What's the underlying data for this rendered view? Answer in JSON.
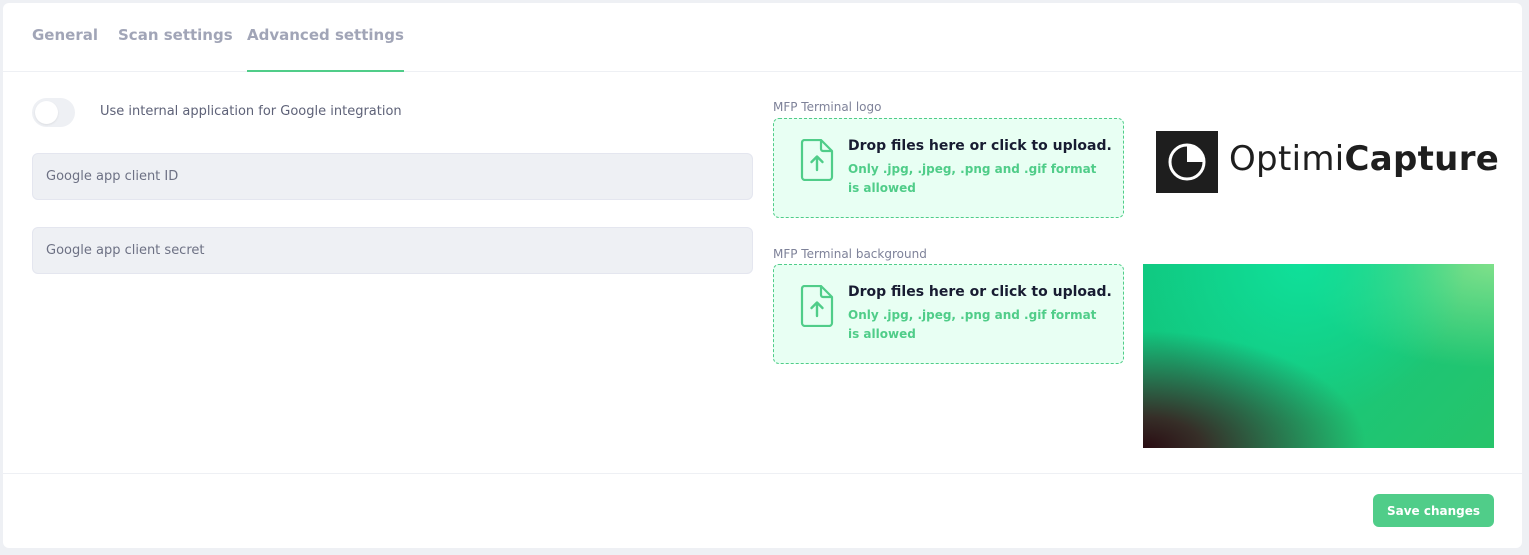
{
  "tabs": [
    {
      "label": "General",
      "active": false
    },
    {
      "label": "Scan settings",
      "active": false
    },
    {
      "label": "Advanced settings",
      "active": true
    }
  ],
  "google_integration": {
    "toggle_label": "Use internal application for Google integration",
    "toggle_on": false,
    "client_id": {
      "value": "",
      "placeholder": "Google app client ID"
    },
    "client_secret": {
      "value": "",
      "placeholder": "Google app client secret"
    }
  },
  "uploads": {
    "logo": {
      "label": "MFP Terminal logo",
      "title": "Drop files here or click to upload.",
      "hint": "Only .jpg, .jpeg, .png and .gif format is allowed"
    },
    "background": {
      "label": "MFP Terminal background",
      "title": "Drop files here or click to upload.",
      "hint": "Only .jpg, .jpeg, .png and .gif format is allowed"
    }
  },
  "logo_preview": {
    "brand_light": "Optimi",
    "brand_bold": "Capture"
  },
  "footer": {
    "save_label": "Save changes"
  },
  "colors": {
    "accent": "#50cd89",
    "dropzone_bg": "#e8fff3",
    "input_bg": "#eef0f4"
  },
  "icons": {
    "upload": "file-upload-icon",
    "logo_mark": "pie-chart-logo-icon"
  }
}
